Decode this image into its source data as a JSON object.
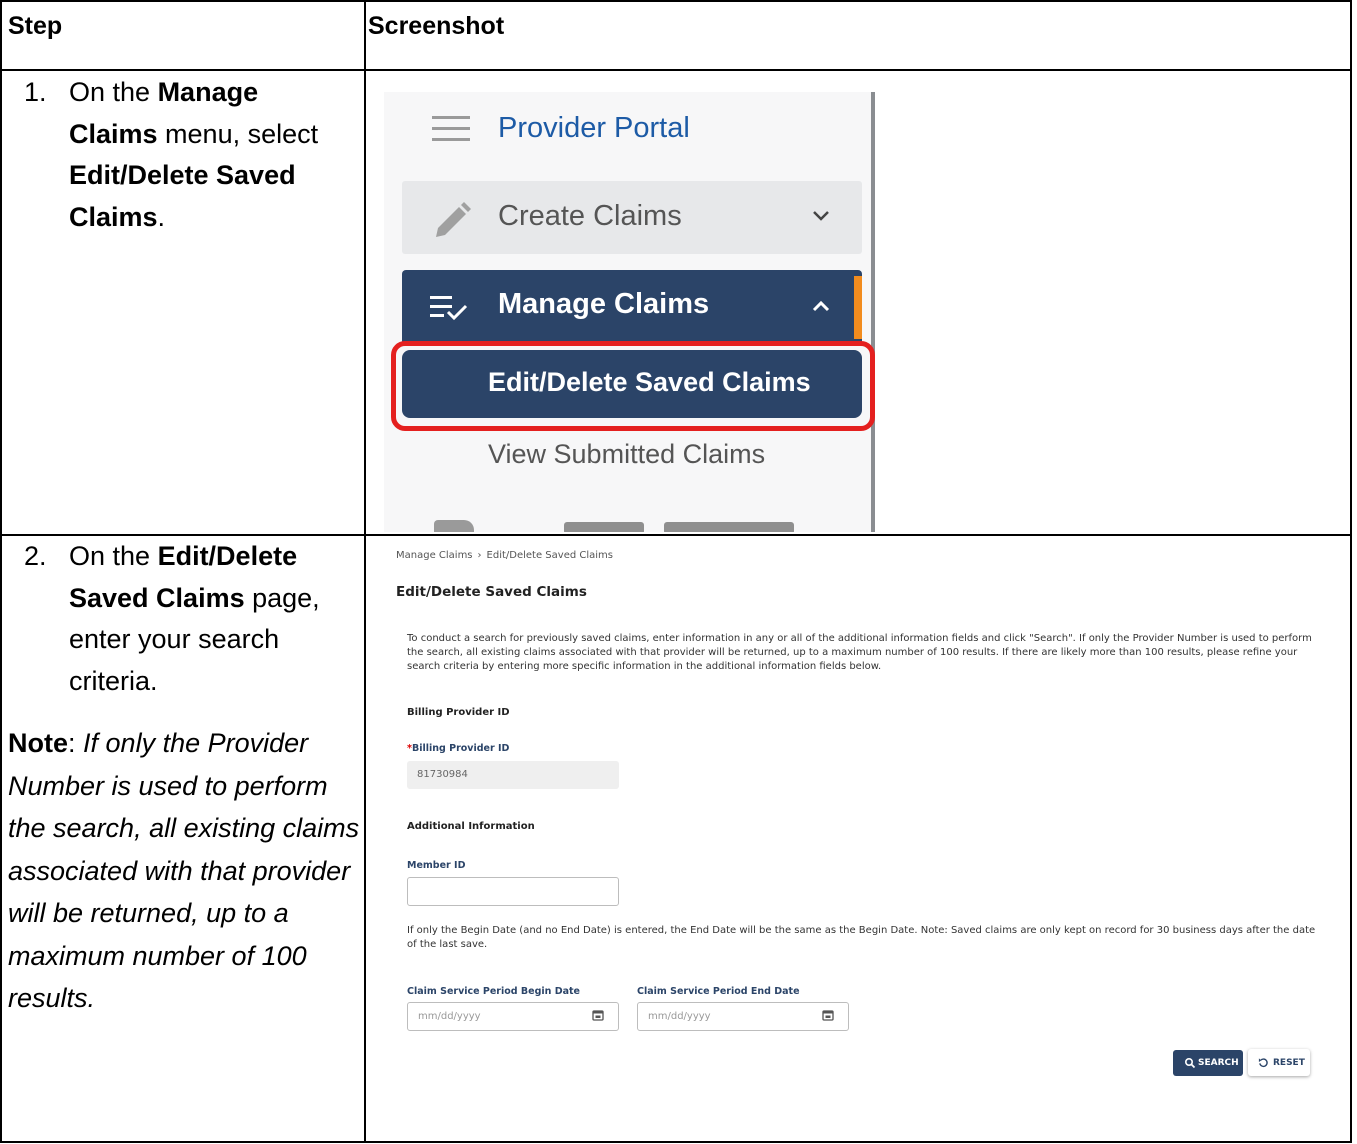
{
  "table": {
    "headers": {
      "step": "Step",
      "screenshot": "Screenshot"
    },
    "rows": [
      {
        "number": "1.",
        "text_parts": [
          "On the ",
          "Manage Claims",
          " menu, select ",
          "Edit/Delete Saved Claims",
          "."
        ]
      },
      {
        "number": "2.",
        "text_parts": [
          "On the ",
          "Edit/Delete Saved Claims",
          " page, enter your search criteria."
        ],
        "note_label": "Note",
        "note_colon": ":",
        "note_text": "If only the Provider Number is used to perform the search, all existing claims associated with that provider will be returned, up to a maximum number of 100 results."
      }
    ]
  },
  "sidebar": {
    "title": "Provider Portal",
    "create_label": "Create Claims",
    "manage_label": "Manage Claims",
    "edit_label": "Edit/Delete Saved Claims",
    "view_label": "View Submitted Claims",
    "icons": [
      "hamburger-icon",
      "pencil-icon",
      "chevron-down-icon",
      "manage-list-icon",
      "chevron-up-icon"
    ],
    "colors": {
      "nav_dark": "#2b4468",
      "accent": "#f28c1e",
      "highlight": "#e4201f",
      "title_blue": "#1d5ba6"
    }
  },
  "form": {
    "breadcrumb": [
      "Manage Claims",
      "Edit/Delete Saved Claims"
    ],
    "breadcrumb_sep": "›",
    "title": "Edit/Delete Saved Claims",
    "intro": "To conduct a search for previously saved claims, enter information in any or all of the additional information fields and click \"Search\". If only the Provider Number is used to perform the search, all existing claims associated with that provider will be returned, up to a maximum number of 100 results. If there are likely more than 100 results, please refine your search criteria by entering more specific information in the additional information fields below.",
    "billing_section": "Billing Provider ID",
    "billing_required_mark": "*",
    "billing_label": "Billing Provider ID",
    "billing_value": "81730984",
    "additional_section": "Additional Information",
    "member_label": "Member ID",
    "member_value": "",
    "date_help": "If only the Begin Date (and no End Date) is entered, the End Date will be the same as the Begin Date. Note: Saved claims are only kept on record for 30 business days after the date of the last save.",
    "begin_label": "Claim Service Period Begin Date",
    "begin_placeholder": "mm/dd/yyyy",
    "end_label": "Claim Service Period End Date",
    "end_placeholder": "mm/dd/yyyy",
    "search_button": "SEARCH",
    "reset_button": "RESET"
  }
}
